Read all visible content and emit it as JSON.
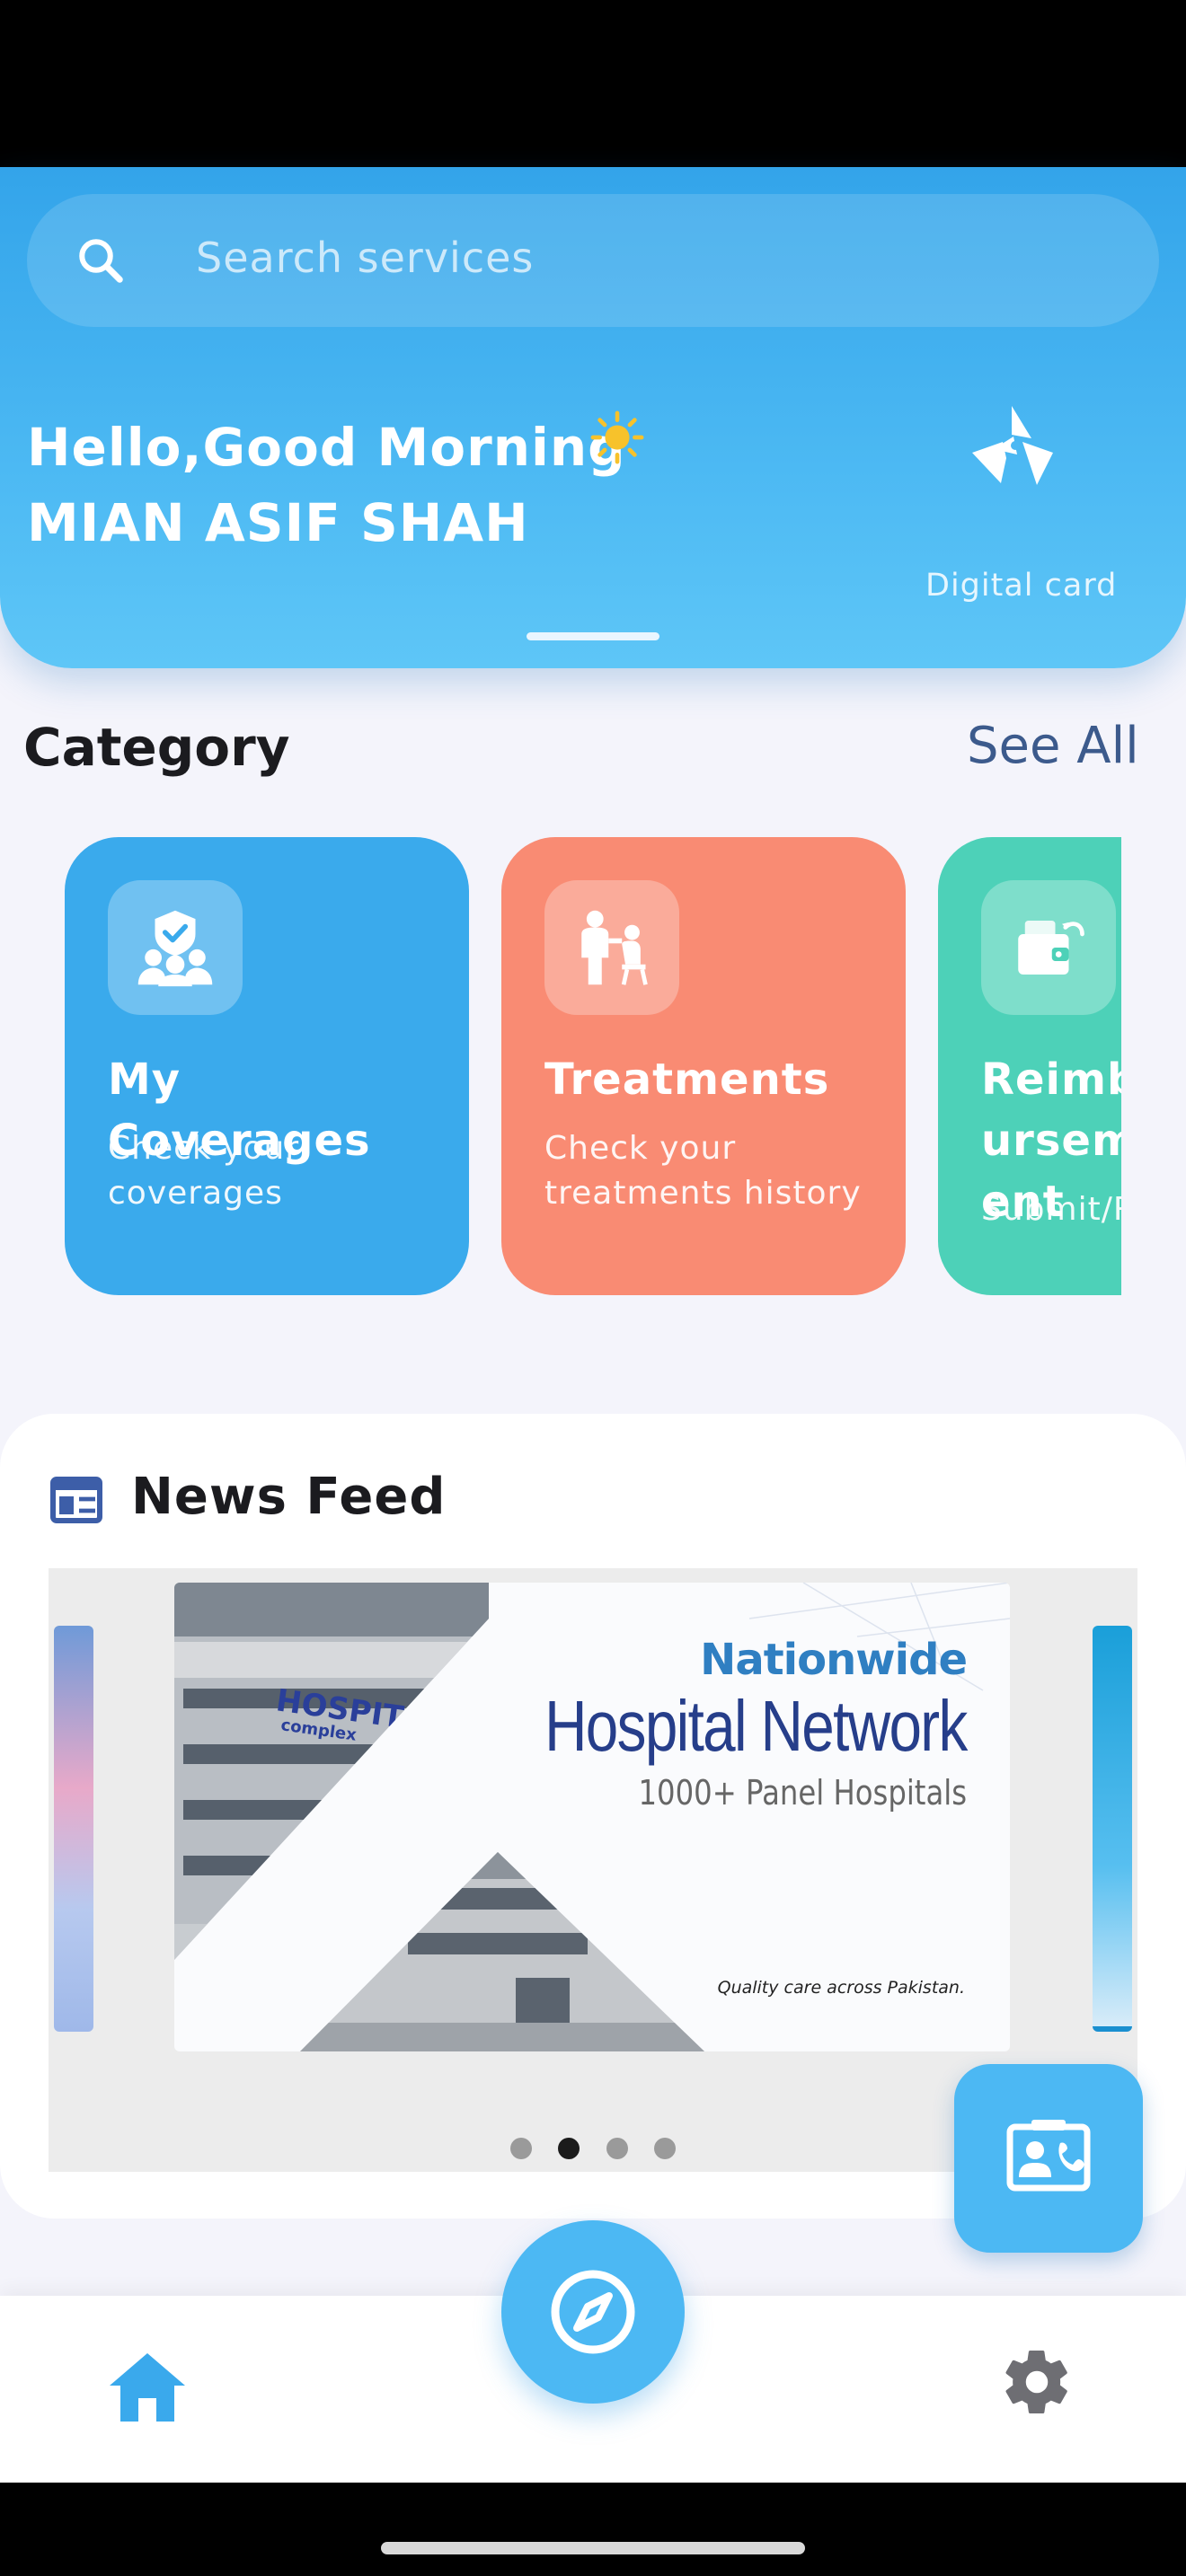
{
  "search": {
    "placeholder": "Search services",
    "icon": "search-icon"
  },
  "greeting": {
    "line1": "Hello,Good Morning",
    "emoji": "sun-icon",
    "name": "MIAN ASIF SHAH"
  },
  "digital_card": {
    "label": "Digital card",
    "icon": "digital-card-logo-icon"
  },
  "category": {
    "title": "Category",
    "see_all": "See All",
    "cards": [
      {
        "title": "My Coverages",
        "subtitle": "Check your coverages",
        "color": "#3aaaec",
        "icon": "coverage-shield-icon"
      },
      {
        "title": "Treatments",
        "subtitle": "Check your treatments history",
        "color": "#f98b73",
        "icon": "treatment-doctor-icon"
      },
      {
        "title": "Reimbursement",
        "subtitle": "Submit/Request claims",
        "color": "#4dd1b8",
        "icon": "wallet-icon"
      }
    ]
  },
  "news_feed": {
    "title": "News Feed",
    "icon": "news-icon",
    "banner": {
      "heading": "Nationwide",
      "title": "Hospital Network",
      "subtitle": "1000+ Panel Hospitals",
      "tagline": "Quality care across Pakistan.",
      "building_sign": "HOSPITAL",
      "building_sign_small": "complex"
    },
    "pages": 4,
    "active_page": 2
  },
  "fab": {
    "contact_icon": "contact-card-icon",
    "center_icon": "compass-icon"
  },
  "bottom_nav": {
    "home_icon": "home-icon",
    "settings_icon": "gear-icon"
  },
  "colors": {
    "primary": "#4cb8f3",
    "header_top": "#33a4ea",
    "treatments": "#f98b73",
    "reimburse": "#4dd1b8",
    "see_all": "#3c5a8c"
  }
}
